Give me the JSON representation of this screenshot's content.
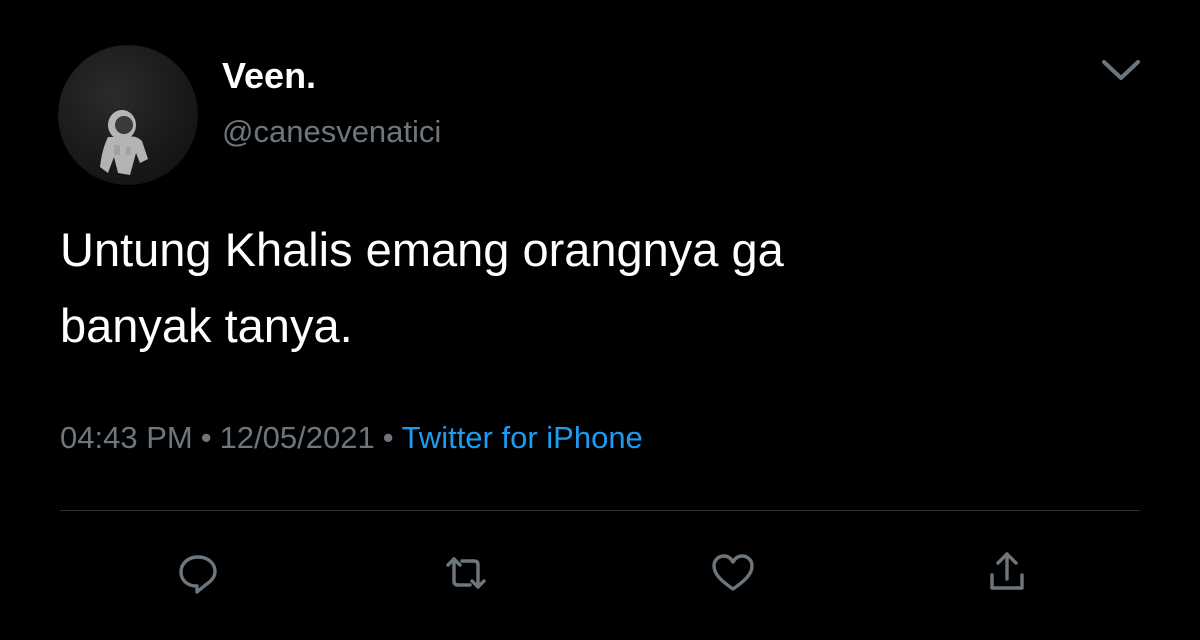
{
  "tweet": {
    "author": {
      "display_name": "Veen.",
      "handle": "@canesvenatici"
    },
    "text_lines": [
      "Untung Khalis emang orangnya ga",
      "banyak tanya."
    ],
    "meta": {
      "time": "04:43 PM",
      "separator": "•",
      "date": "12/05/2021",
      "source": "Twitter for iPhone"
    }
  },
  "icons": {
    "menu": "chevron-down-icon",
    "reply": "reply-icon",
    "retweet": "retweet-icon",
    "like": "heart-icon",
    "share": "share-icon"
  },
  "colors": {
    "background": "#000000",
    "text_primary": "#ffffff",
    "text_secondary": "#6e767d",
    "link": "#1d9bf0",
    "divider": "#2f3336"
  }
}
